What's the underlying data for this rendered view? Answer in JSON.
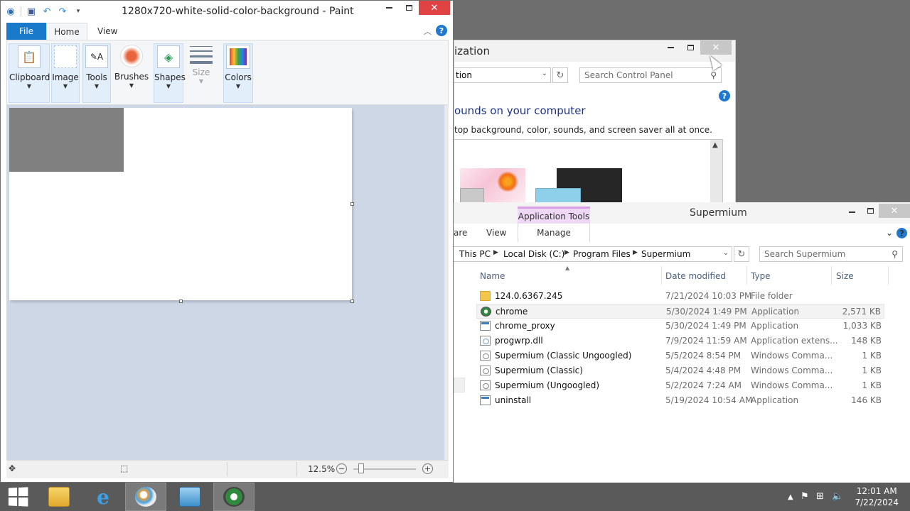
{
  "control_panel": {
    "title": "ization",
    "address_text": "tion",
    "search_placeholder": "Search Control Panel",
    "heading": "ounds on your computer",
    "description": "top background, color, sounds, and screen saver all at once."
  },
  "explorer": {
    "title": "Supermium",
    "contextual_tab_label": "Application Tools",
    "ribbon_tabs": [
      "are",
      "View",
      "Manage"
    ],
    "breadcrumb": [
      "This PC",
      "Local Disk (C:)",
      "Program Files",
      "Supermium"
    ],
    "search_placeholder": "Search Supermium",
    "columns": {
      "name": "Name",
      "date": "Date modified",
      "type": "Type",
      "size": "Size"
    },
    "files": [
      {
        "name": "124.0.6367.245",
        "date": "7/21/2024 10:03 PM",
        "type": "File folder",
        "size": "",
        "icon": "folder-icon"
      },
      {
        "name": "chrome",
        "date": "5/30/2024 1:49 PM",
        "type": "Application",
        "size": "2,571 KB",
        "icon": "chrome-icon",
        "selected": true
      },
      {
        "name": "chrome_proxy",
        "date": "5/30/2024 1:49 PM",
        "type": "Application",
        "size": "1,033 KB",
        "icon": "application-icon"
      },
      {
        "name": "progwrp.dll",
        "date": "7/9/2024 11:59 AM",
        "type": "Application extens...",
        "size": "148 KB",
        "icon": "dll-icon"
      },
      {
        "name": "Supermium (Classic Ungoogled)",
        "date": "5/5/2024 8:54 PM",
        "type": "Windows Comma...",
        "size": "1 KB",
        "icon": "cmd-icon"
      },
      {
        "name": "Supermium (Classic)",
        "date": "5/4/2024 4:48 PM",
        "type": "Windows Comma...",
        "size": "1 KB",
        "icon": "cmd-icon"
      },
      {
        "name": "Supermium (Ungoogled)",
        "date": "5/2/2024 7:24 AM",
        "type": "Windows Comma...",
        "size": "1 KB",
        "icon": "cmd-icon"
      },
      {
        "name": "uninstall",
        "date": "5/19/2024 10:54 AM",
        "type": "Application",
        "size": "146 KB",
        "icon": "application-icon"
      }
    ]
  },
  "paint": {
    "title": "1280x720-white-solid-color-background - Paint",
    "tabs": {
      "file": "File",
      "home": "Home",
      "view": "View"
    },
    "groups": {
      "clipboard": "Clipboard",
      "image": "Image",
      "tools": "Tools",
      "brushes": "Brushes",
      "shapes": "Shapes",
      "size": "Size",
      "colors": "Colors"
    },
    "zoom": "12.5%",
    "zoom_fraction": 0.08
  },
  "taskbar": {
    "time": "12:01 AM",
    "date": "7/22/2024"
  },
  "colors": {
    "accent": "#1979ca",
    "close_red": "#e04343",
    "canvas_gray": "#808080"
  }
}
